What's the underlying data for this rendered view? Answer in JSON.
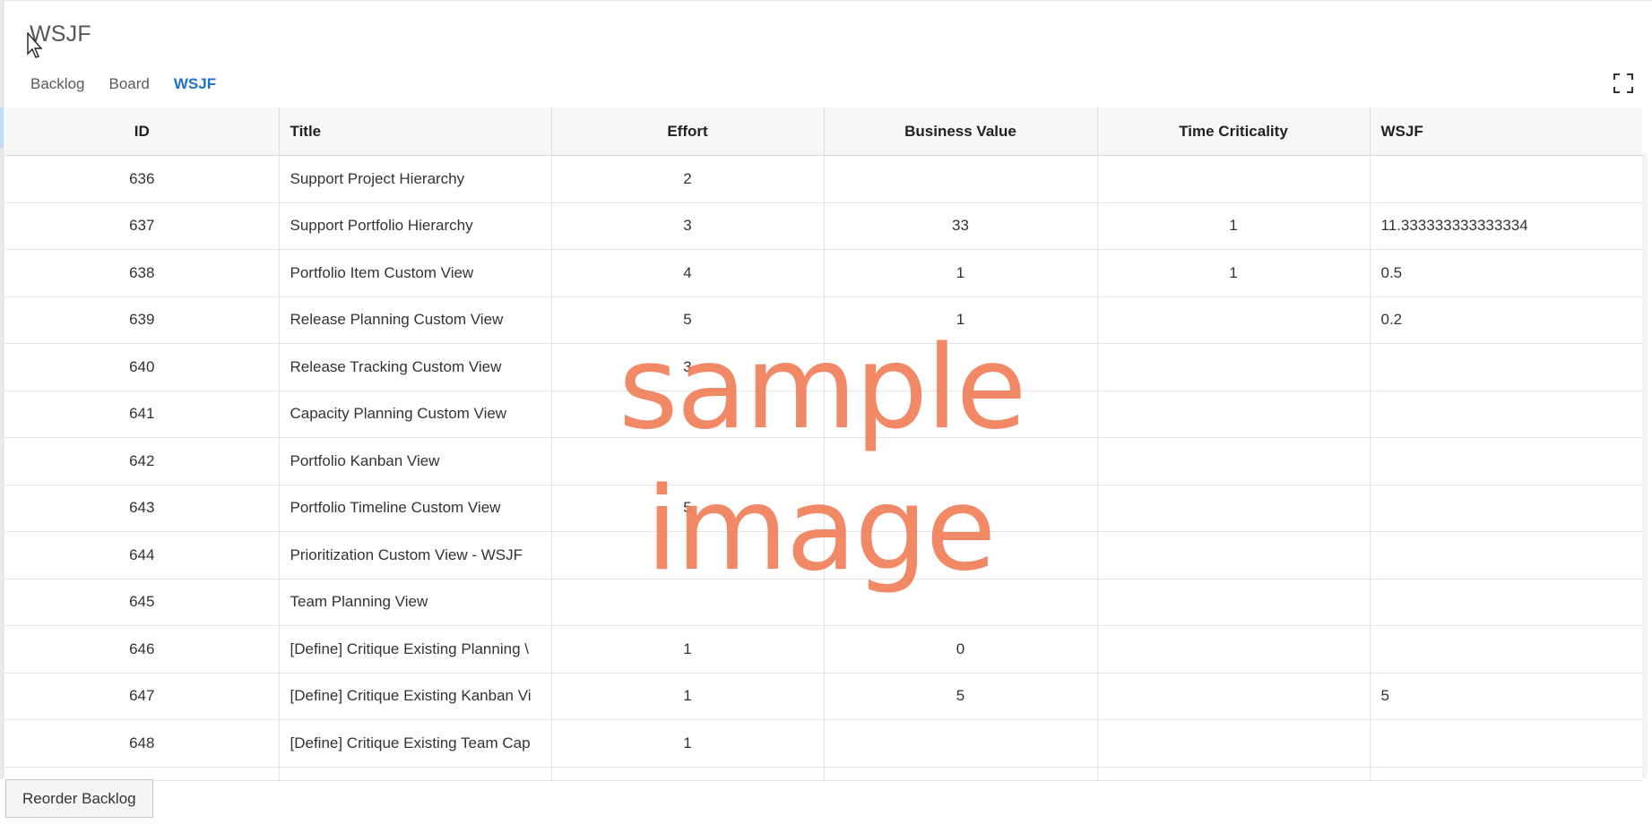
{
  "app": {
    "title": "WSJF"
  },
  "tabs": [
    {
      "label": "Backlog",
      "active": false
    },
    {
      "label": "Board",
      "active": false
    },
    {
      "label": "WSJF",
      "active": true
    }
  ],
  "toolbar": {
    "fullscreen_icon": "expand-icon"
  },
  "table": {
    "columns": [
      "ID",
      "Title",
      "Effort",
      "Business Value",
      "Time Criticality",
      "WSJF"
    ],
    "rows": [
      {
        "id": "636",
        "title": "Support Project Hierarchy",
        "effort": "2",
        "business_value": "",
        "time_criticality": "",
        "wsjf": ""
      },
      {
        "id": "637",
        "title": "Support Portfolio Hierarchy",
        "effort": "3",
        "business_value": "33",
        "time_criticality": "1",
        "wsjf": "11.333333333333334"
      },
      {
        "id": "638",
        "title": "Portfolio Item Custom View",
        "effort": "4",
        "business_value": "1",
        "time_criticality": "1",
        "wsjf": "0.5"
      },
      {
        "id": "639",
        "title": "Release Planning Custom View",
        "effort": "5",
        "business_value": "1",
        "time_criticality": "",
        "wsjf": "0.2"
      },
      {
        "id": "640",
        "title": "Release Tracking Custom View",
        "effort": "3",
        "business_value": "",
        "time_criticality": "",
        "wsjf": ""
      },
      {
        "id": "641",
        "title": "Capacity Planning Custom View",
        "effort": "",
        "business_value": "",
        "time_criticality": "",
        "wsjf": ""
      },
      {
        "id": "642",
        "title": "Portfolio Kanban View",
        "effort": "",
        "business_value": "",
        "time_criticality": "",
        "wsjf": ""
      },
      {
        "id": "643",
        "title": "Portfolio Timeline Custom View",
        "effort": "5",
        "business_value": "",
        "time_criticality": "",
        "wsjf": ""
      },
      {
        "id": "644",
        "title": "Prioritization Custom View - WSJF",
        "effort": "",
        "business_value": "",
        "time_criticality": "",
        "wsjf": ""
      },
      {
        "id": "645",
        "title": "Team Planning View",
        "effort": "",
        "business_value": "",
        "time_criticality": "",
        "wsjf": ""
      },
      {
        "id": "646",
        "title": "[Define] Critique Existing Planning \\",
        "effort": "1",
        "business_value": "0",
        "time_criticality": "",
        "wsjf": ""
      },
      {
        "id": "647",
        "title": "[Define] Critique Existing Kanban Vi",
        "effort": "1",
        "business_value": "5",
        "time_criticality": "",
        "wsjf": "5"
      },
      {
        "id": "648",
        "title": "[Define] Critique Existing Team Cap",
        "effort": "1",
        "business_value": "",
        "time_criticality": "",
        "wsjf": ""
      }
    ]
  },
  "watermark": {
    "line1": "sample",
    "line2": "image",
    "color": "#f07f5a"
  },
  "actions": {
    "reorder_label": "Reorder Backlog"
  },
  "colors": {
    "accent": "#1c73c9",
    "header_bg": "#f7f7f7"
  }
}
